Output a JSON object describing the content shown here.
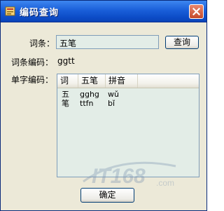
{
  "window": {
    "title": "编码查询",
    "close_label": "×"
  },
  "form": {
    "entry_label": "词条：",
    "entry_value": "五笔",
    "query_button": "查询",
    "entry_code_label": "词条编码：",
    "entry_code_value": "ggtt",
    "char_code_label": "单字编码："
  },
  "table": {
    "columns": [
      "词",
      "五笔",
      "拼音"
    ],
    "rows": [
      {
        "char": "五",
        "wubi": "gghg",
        "pinyin": "wǔ"
      },
      {
        "char": "笔",
        "wubi": "ttfn",
        "pinyin": "bǐ"
      }
    ]
  },
  "watermark": {
    "text": "IT168",
    "suffix": ".com"
  },
  "footer": {
    "ok_button": "确定"
  }
}
